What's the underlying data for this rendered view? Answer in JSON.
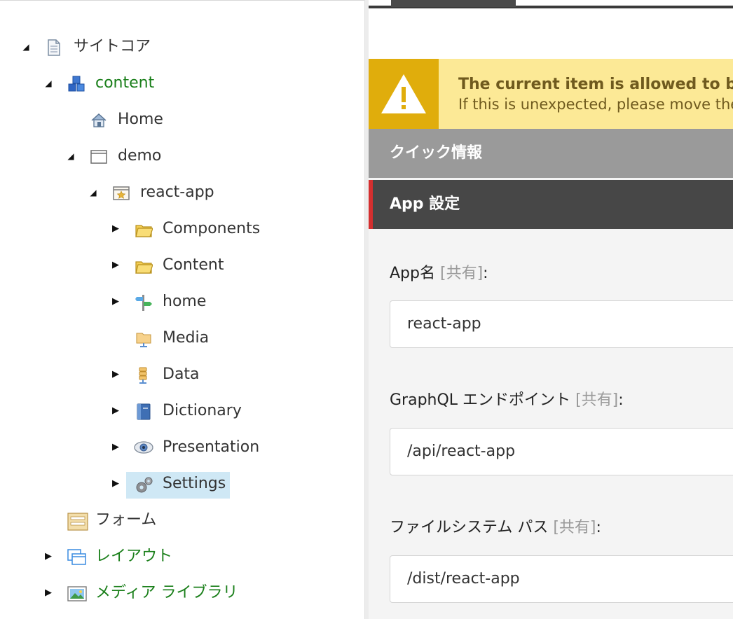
{
  "tree": {
    "nodes": [
      {
        "label": "サイトコア",
        "icon": "page-icon",
        "toggle": "expanded"
      },
      {
        "label": "content",
        "icon": "content-cubes-icon",
        "toggle": "expanded"
      },
      {
        "label": "Home",
        "icon": "home-icon",
        "toggle": "none"
      },
      {
        "label": "demo",
        "icon": "window-icon",
        "toggle": "expanded"
      },
      {
        "label": "react-app",
        "icon": "star-window-icon",
        "toggle": "expanded"
      },
      {
        "label": "Components",
        "icon": "folder-icon",
        "toggle": "collapsed"
      },
      {
        "label": "Content",
        "icon": "folder-icon",
        "toggle": "collapsed"
      },
      {
        "label": "home",
        "icon": "signpost-icon",
        "toggle": "collapsed"
      },
      {
        "label": "Media",
        "icon": "media-folder-icon",
        "toggle": "none"
      },
      {
        "label": "Data",
        "icon": "data-icon",
        "toggle": "collapsed"
      },
      {
        "label": "Dictionary",
        "icon": "book-icon",
        "toggle": "collapsed"
      },
      {
        "label": "Presentation",
        "icon": "eye-icon",
        "toggle": "collapsed"
      },
      {
        "label": "Settings",
        "icon": "gears-icon",
        "toggle": "collapsed",
        "selected": true
      },
      {
        "label": "フォーム",
        "icon": "form-icon",
        "toggle": "none"
      },
      {
        "label": "レイアウト",
        "icon": "layout-icon",
        "toggle": "collapsed"
      },
      {
        "label": "メディア ライブラリ",
        "icon": "image-icon",
        "toggle": "collapsed"
      }
    ]
  },
  "warning": {
    "line1": "The current item is allowed to be",
    "line2": "If this is unexpected, please move the"
  },
  "sections": {
    "quick_info": "クイック情報",
    "app_settings": "App 設定"
  },
  "fields": {
    "app_name": {
      "label": "App名",
      "shared": "[共有]",
      "colon": ":",
      "value": "react-app"
    },
    "graphql": {
      "label": "GraphQL エンドポイント",
      "shared": "[共有]",
      "colon": ":",
      "value": "/api/react-app"
    },
    "filesystem": {
      "label": "ファイルシステム パス",
      "shared": "[共有]",
      "colon": ":",
      "value": "/dist/react-app"
    }
  },
  "colors": {
    "green_text": "#1a7f1a",
    "warning_bg": "#fce996",
    "warning_icon_bg": "#e0ad0c",
    "section_quick": "#9a9a9a",
    "section_app": "#474747",
    "accent_red": "#d42f2f",
    "selected_bg": "#cfe8f5"
  }
}
